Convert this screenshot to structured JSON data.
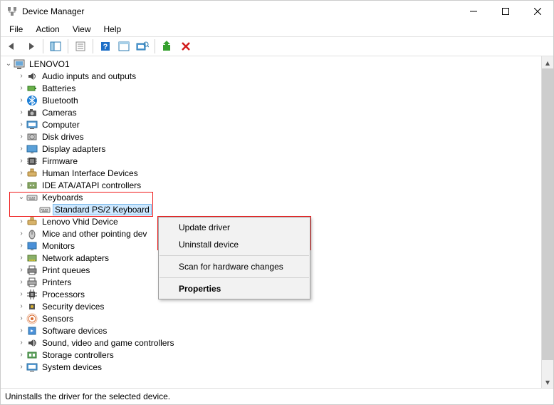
{
  "window": {
    "title": "Device Manager"
  },
  "menubar": [
    "File",
    "Action",
    "View",
    "Help"
  ],
  "tree": {
    "root": "LENOVO1",
    "categories": [
      {
        "label": "Audio inputs and outputs",
        "icon": "speaker"
      },
      {
        "label": "Batteries",
        "icon": "battery"
      },
      {
        "label": "Bluetooth",
        "icon": "bluetooth"
      },
      {
        "label": "Cameras",
        "icon": "camera"
      },
      {
        "label": "Computer",
        "icon": "computer"
      },
      {
        "label": "Disk drives",
        "icon": "disk"
      },
      {
        "label": "Display adapters",
        "icon": "display"
      },
      {
        "label": "Firmware",
        "icon": "firmware"
      },
      {
        "label": "Human Interface Devices",
        "icon": "hid"
      },
      {
        "label": "IDE ATA/ATAPI controllers",
        "icon": "ide"
      },
      {
        "label": "Keyboards",
        "icon": "keyboard",
        "expanded": true,
        "children": [
          {
            "label": "Standard PS/2 Keyboard",
            "icon": "keyboard",
            "selected": true
          }
        ]
      },
      {
        "label": "Lenovo Vhid Device",
        "icon": "hid"
      },
      {
        "label": "Mice and other pointing devices",
        "icon": "mouse",
        "truncated": "Mice and other pointing dev"
      },
      {
        "label": "Monitors",
        "icon": "monitor"
      },
      {
        "label": "Network adapters",
        "icon": "network"
      },
      {
        "label": "Print queues",
        "icon": "printqueue"
      },
      {
        "label": "Printers",
        "icon": "printer"
      },
      {
        "label": "Processors",
        "icon": "cpu"
      },
      {
        "label": "Security devices",
        "icon": "security"
      },
      {
        "label": "Sensors",
        "icon": "sensor"
      },
      {
        "label": "Software devices",
        "icon": "software"
      },
      {
        "label": "Sound, video and game controllers",
        "icon": "sound"
      },
      {
        "label": "Storage controllers",
        "icon": "storage"
      },
      {
        "label": "System devices",
        "icon": "system",
        "truncatedLabel": "System devices"
      }
    ]
  },
  "context_menu": {
    "items": [
      {
        "label": "Update driver",
        "bold": false
      },
      {
        "label": "Uninstall device",
        "bold": false
      }
    ],
    "items2": [
      {
        "label": "Scan for hardware changes",
        "bold": false
      }
    ],
    "items3": [
      {
        "label": "Properties",
        "bold": true
      }
    ]
  },
  "statusbar": "Uninstalls the driver for the selected device."
}
